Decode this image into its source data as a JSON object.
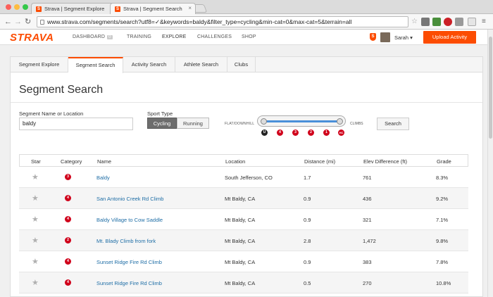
{
  "browser": {
    "tabs": [
      {
        "title": "Strava | Segment Explore",
        "active": false
      },
      {
        "title": "Strava | Segment Search",
        "active": true
      }
    ],
    "url": "www.strava.com/segments/search?utf8=✓&keywords=baldy&filter_type=cycling&min-cat=0&max-cat=5&terrain=all"
  },
  "nav": {
    "logo": "STRAVA",
    "links": [
      "DASHBOARD",
      "TRAINING",
      "EXPLORE",
      "CHALLENGES",
      "SHOP"
    ],
    "dashboard_badge": "0",
    "user": "Sarah",
    "user_caret": "▾",
    "upload": "Upload Activity"
  },
  "page_tabs": [
    "Segment Explore",
    "Segment Search",
    "Activity Search",
    "Athlete Search",
    "Clubs"
  ],
  "title": "Segment Search",
  "form": {
    "name_label": "Segment Name or Location",
    "name_value": "baldy",
    "sport_label": "Sport Type",
    "sport_options": [
      "Cycling",
      "Running"
    ],
    "sport_selected": "Cycling",
    "terrain_left": "FLAT/DOWNHILL",
    "terrain_right": "CLIMBS",
    "categories": [
      "U",
      "4",
      "3",
      "2",
      "1",
      "HC"
    ],
    "search": "Search"
  },
  "table": {
    "headers": [
      "Star",
      "Category",
      "Name",
      "Location",
      "Distance (mi)",
      "Elev Difference (ft)",
      "Grade"
    ],
    "rows": [
      {
        "cat": "3",
        "name": "Baldy",
        "location": "South Jefferson, CO",
        "distance": "1.7",
        "elev": "761",
        "grade": "8.3%"
      },
      {
        "cat": "4",
        "name": "San Antonio Creek Rd Climb",
        "location": "Mt Baldy, CA",
        "distance": "0.9",
        "elev": "436",
        "grade": "9.2%"
      },
      {
        "cat": "4",
        "name": "Baldy Village to Cow Saddle",
        "location": "Mt Baldy, CA",
        "distance": "0.9",
        "elev": "321",
        "grade": "7.1%"
      },
      {
        "cat": "2",
        "name": "Mt. Blady Climb from fork",
        "location": "Mt Baldy, CA",
        "distance": "2.8",
        "elev": "1,472",
        "grade": "9.8%"
      },
      {
        "cat": "4",
        "name": "Sunset Ridge Fire Rd Climb",
        "location": "Mt Baldy, CA",
        "distance": "0.9",
        "elev": "383",
        "grade": "7.8%"
      },
      {
        "cat": "4",
        "name": "Sunset Ridge Fire Rd Climb",
        "location": "Mt Baldy, CA",
        "distance": "0.5",
        "elev": "270",
        "grade": "10.8%"
      }
    ]
  },
  "colors": {
    "brand": "#fc4c02",
    "category": "#d0021b",
    "link": "#1f6ea6"
  }
}
